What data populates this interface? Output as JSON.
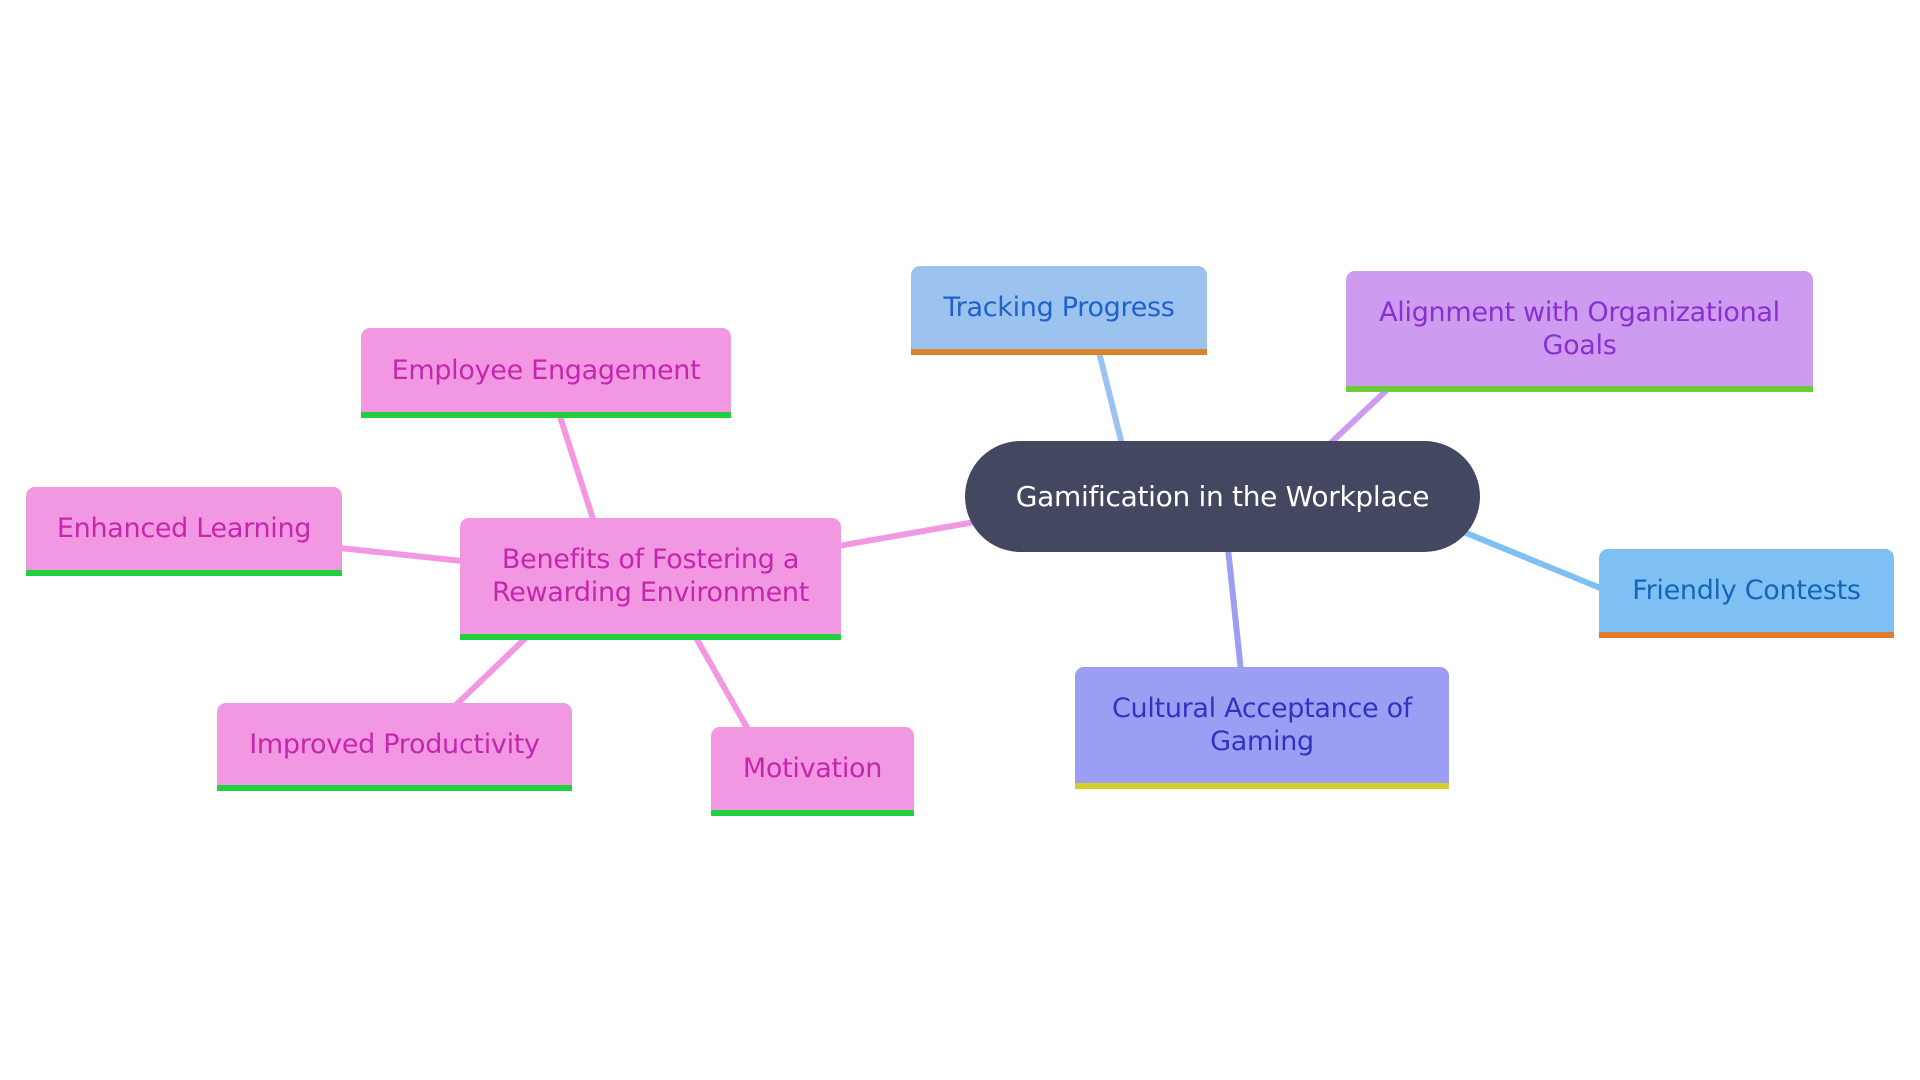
{
  "diagram": {
    "type": "mindmap",
    "root": {
      "id": "root",
      "label": "Gamification in the Workplace",
      "fill": "#434760",
      "text_color": "#ffffff"
    },
    "nodes": [
      {
        "id": "tracking",
        "label": "Tracking Progress",
        "parent": "root",
        "fill": "#9cc2f0",
        "text_color": "#1f62c9",
        "bar_color": "#d7842b",
        "edge_color": "#9cc2f0"
      },
      {
        "id": "alignment",
        "label": "Alignment with Organizational Goals",
        "parent": "root",
        "fill": "#cd9bf0",
        "text_color": "#8a2fd0",
        "bar_color": "#6ccb38",
        "edge_color": "#cd9bf0"
      },
      {
        "id": "friendly",
        "label": "Friendly Contests",
        "parent": "root",
        "fill": "#7ec0f3",
        "text_color": "#1466b8",
        "bar_color": "#e37b2d",
        "edge_color": "#7ec0f3"
      },
      {
        "id": "cultural",
        "label": "Cultural Acceptance of Gaming",
        "parent": "root",
        "fill": "#9b9ef3",
        "text_color": "#2f35c2",
        "bar_color": "#d4cf27",
        "edge_color": "#9b9ef3"
      },
      {
        "id": "benefits",
        "label": "Benefits of Fostering a Rewarding Environment",
        "parent": "root",
        "fill": "#f298e3",
        "text_color": "#c626ae",
        "bar_color": "#22cf3f",
        "edge_color": "#f298e3"
      },
      {
        "id": "engagement",
        "label": "Employee Engagement",
        "parent": "benefits",
        "fill": "#f298e3",
        "text_color": "#c626ae",
        "bar_color": "#22cf3f",
        "edge_color": "#f298e3"
      },
      {
        "id": "learning",
        "label": "Enhanced Learning",
        "parent": "benefits",
        "fill": "#f298e3",
        "text_color": "#c626ae",
        "bar_color": "#22cf3f",
        "edge_color": "#f298e3"
      },
      {
        "id": "productivity",
        "label": "Improved Productivity",
        "parent": "benefits",
        "fill": "#f298e3",
        "text_color": "#c626ae",
        "bar_color": "#22cf3f",
        "edge_color": "#f298e3"
      },
      {
        "id": "motivation",
        "label": "Motivation",
        "parent": "benefits",
        "fill": "#f298e3",
        "text_color": "#c626ae",
        "bar_color": "#22cf3f",
        "edge_color": "#f298e3"
      }
    ]
  }
}
